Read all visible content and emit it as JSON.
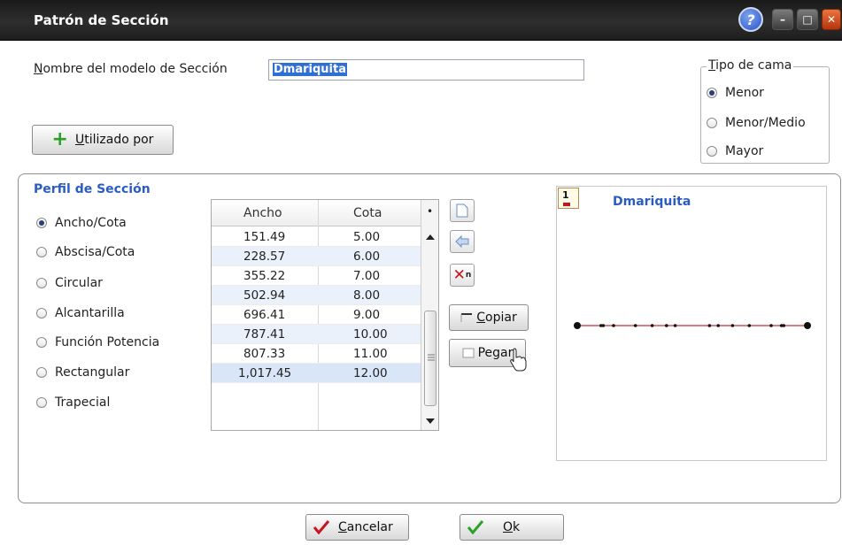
{
  "window": {
    "title": "Patrón de Sección",
    "controls": {
      "help": "?",
      "minimize": "–",
      "maximize": "□",
      "close": "✕"
    }
  },
  "form": {
    "name_label_u": "N",
    "name_label_rest": "ombre del modelo de Sección",
    "name_value": "Dmariquita"
  },
  "bed_type": {
    "legend_u": "T",
    "legend_rest": "ipo de cama",
    "options": [
      {
        "label": "Menor",
        "selected": true
      },
      {
        "label": "Menor/Medio",
        "selected": false
      },
      {
        "label": "Mayor",
        "selected": false
      }
    ]
  },
  "used_by_button": {
    "label_u": "U",
    "label_rest": "tilizado por",
    "icon": "plus-icon"
  },
  "profile": {
    "title": "Perfil de Sección",
    "types": [
      {
        "label": "Ancho/Cota",
        "selected": true
      },
      {
        "label": "Abscisa/Cota",
        "selected": false
      },
      {
        "label": "Circular",
        "selected": false
      },
      {
        "label": "Alcantarilla",
        "selected": false
      },
      {
        "label": "Función Potencia",
        "selected": false
      },
      {
        "label": "Rectangular",
        "selected": false
      },
      {
        "label": "Trapecial",
        "selected": false
      }
    ]
  },
  "table": {
    "columns": [
      "Ancho",
      "Cota"
    ],
    "menu_glyph": "•",
    "rows": [
      [
        "151.49",
        "5.00"
      ],
      [
        "228.57",
        "6.00"
      ],
      [
        "355.22",
        "7.00"
      ],
      [
        "502.94",
        "8.00"
      ],
      [
        "696.41",
        "9.00"
      ],
      [
        "787.41",
        "10.00"
      ],
      [
        "807.33",
        "11.00"
      ],
      [
        "1,017.45",
        "12.00"
      ]
    ]
  },
  "row_tools": {
    "copy_label_u": "C",
    "copy_label_rest": "opiar",
    "paste_label": "Pegar",
    "delete_suffix": "n"
  },
  "preview": {
    "title": "Dmariquita",
    "corner_glyph": "1",
    "profile_color": "#e07b86",
    "point_color": "#111111"
  },
  "footer": {
    "cancel_label_u": "C",
    "cancel_label_rest": "ancelar",
    "ok_label_u": "O",
    "ok_label_rest": "k"
  },
  "colors": {
    "accent_blue": "#2c5cc0",
    "selection_blue": "#2f6fd6",
    "cancel_red": "#c8141e",
    "ok_green": "#2aa22a"
  }
}
